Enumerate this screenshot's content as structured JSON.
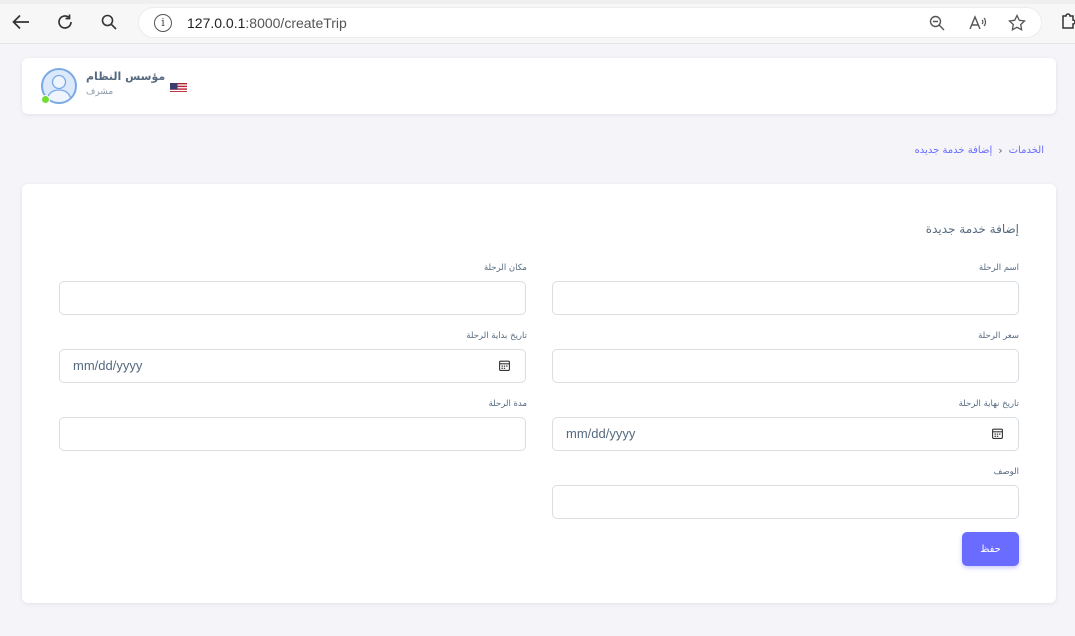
{
  "browser": {
    "url_host": "127.0.0.1",
    "url_rest": ":8000/createTrip"
  },
  "navbar": {
    "user_name": "مؤسس النظام",
    "user_role": "مشرف",
    "language_flag": "us-flag-icon"
  },
  "breadcrumb": {
    "items": [
      "الخدمات",
      "إضافة خدمة جديده"
    ]
  },
  "form": {
    "title": "إضافة خدمة جديدة",
    "fields": {
      "trip_name": {
        "label": "اسم الرحلة",
        "value": ""
      },
      "trip_place": {
        "label": "مكان الرحلة",
        "value": ""
      },
      "trip_price": {
        "label": "سعر الرحلة",
        "value": ""
      },
      "trip_start": {
        "label": "تاريخ بداية الرحلة",
        "placeholder": "mm/dd/yyyy"
      },
      "trip_end": {
        "label": "تاريخ نهاية الرحلة",
        "placeholder": "mm/dd/yyyy"
      },
      "trip_duration": {
        "label": "مدة الرحلة",
        "value": ""
      },
      "description": {
        "label": "الوصف",
        "value": ""
      }
    },
    "save_label": "حفظ"
  },
  "colors": {
    "accent": "#696cff",
    "background": "#f5f5f9",
    "card": "#ffffff",
    "online": "#71dd37"
  }
}
